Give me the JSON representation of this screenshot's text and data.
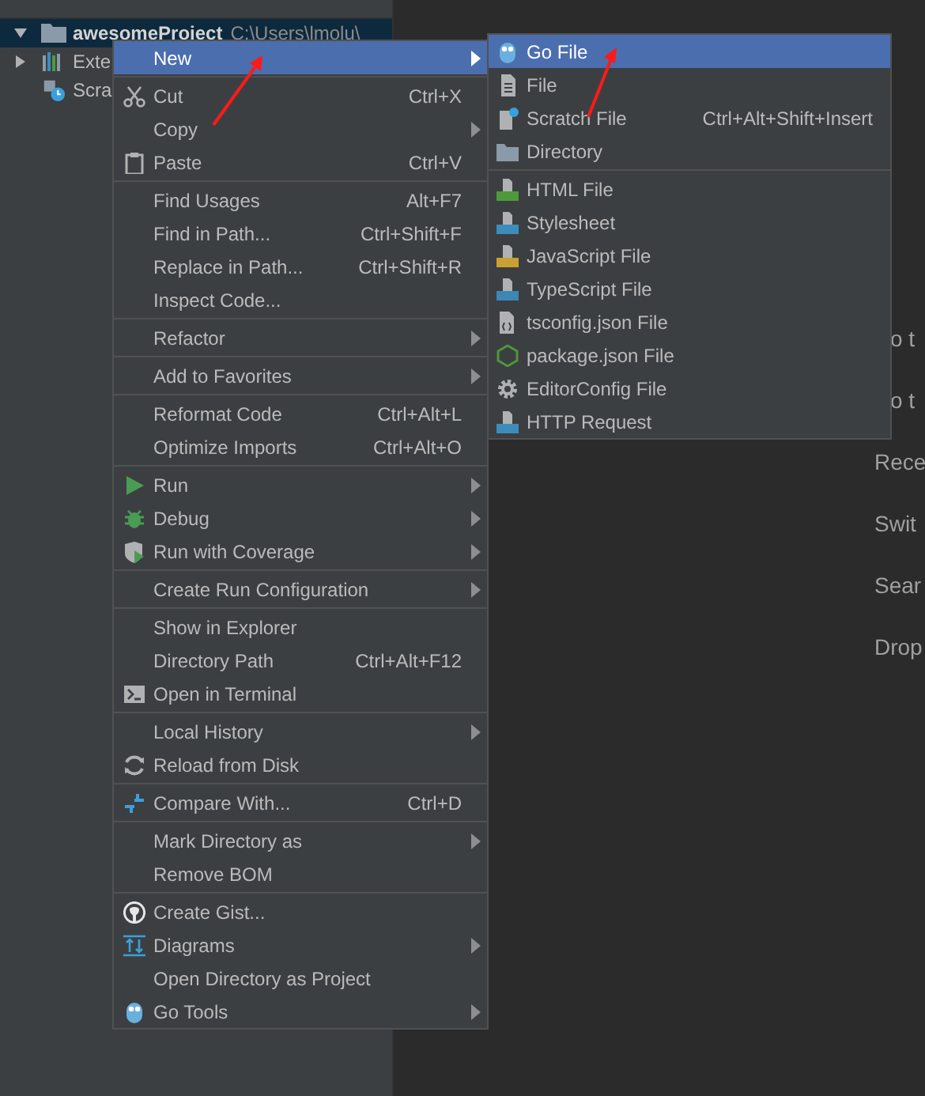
{
  "tree": [
    {
      "label": "awesomeProject",
      "path": "C:\\Users\\lmolu\\",
      "expanded": true,
      "selected": true,
      "bold": true
    },
    {
      "label": "Exte",
      "expanded": false,
      "selected": false,
      "bold": false
    },
    {
      "label": "Scra",
      "selected": false,
      "bold": false
    }
  ],
  "editor_hints": [
    "o t",
    "o t",
    "Rece",
    "Swit",
    "Sear",
    "Drop"
  ],
  "context_menu": {
    "groups": [
      [
        {
          "label": "New",
          "submenu": true,
          "selected": true
        }
      ],
      [
        {
          "label": "Cut",
          "shortcut": "Ctrl+X",
          "submenu": false,
          "selected": false
        },
        {
          "label": "Copy",
          "submenu": true,
          "selected": false
        },
        {
          "label": "Paste",
          "shortcut": "Ctrl+V",
          "submenu": false,
          "selected": false
        }
      ],
      [
        {
          "label": "Find Usages",
          "shortcut": "Alt+F7",
          "submenu": false,
          "selected": false
        },
        {
          "label": "Find in Path...",
          "shortcut": "Ctrl+Shift+F",
          "submenu": false,
          "selected": false
        },
        {
          "label": "Replace in Path...",
          "shortcut": "Ctrl+Shift+R",
          "submenu": false,
          "selected": false
        },
        {
          "label": "Inspect Code...",
          "submenu": false,
          "selected": false
        }
      ],
      [
        {
          "label": "Refactor",
          "submenu": true,
          "selected": false
        }
      ],
      [
        {
          "label": "Add to Favorites",
          "submenu": true,
          "selected": false
        }
      ],
      [
        {
          "label": "Reformat Code",
          "shortcut": "Ctrl+Alt+L",
          "submenu": false,
          "selected": false
        },
        {
          "label": "Optimize Imports",
          "shortcut": "Ctrl+Alt+O",
          "submenu": false,
          "selected": false
        }
      ],
      [
        {
          "label": "Run",
          "submenu": true,
          "selected": false
        },
        {
          "label": "Debug",
          "submenu": true,
          "selected": false
        },
        {
          "label": "Run with Coverage",
          "submenu": true,
          "selected": false
        }
      ],
      [
        {
          "label": "Create Run Configuration",
          "submenu": true,
          "selected": false
        }
      ],
      [
        {
          "label": "Show in Explorer",
          "submenu": false,
          "selected": false
        },
        {
          "label": "Directory Path",
          "shortcut": "Ctrl+Alt+F12",
          "submenu": false,
          "selected": false
        },
        {
          "label": "Open in Terminal",
          "submenu": false,
          "selected": false
        }
      ],
      [
        {
          "label": "Local History",
          "submenu": true,
          "selected": false
        },
        {
          "label": "Reload from Disk",
          "submenu": false,
          "selected": false
        }
      ],
      [
        {
          "label": "Compare With...",
          "shortcut": "Ctrl+D",
          "submenu": false,
          "selected": false
        }
      ],
      [
        {
          "label": "Mark Directory as",
          "submenu": true,
          "selected": false
        },
        {
          "label": "Remove BOM",
          "submenu": false,
          "selected": false
        }
      ],
      [
        {
          "label": "Create Gist...",
          "submenu": false,
          "selected": false
        },
        {
          "label": "Diagrams",
          "submenu": true,
          "selected": false
        },
        {
          "label": "Open Directory as Project",
          "submenu": false,
          "selected": false
        },
        {
          "label": "Go Tools",
          "submenu": true,
          "selected": false
        }
      ]
    ]
  },
  "new_submenu": {
    "groups": [
      [
        {
          "label": "Go File",
          "selected": true
        },
        {
          "label": "File",
          "selected": false
        },
        {
          "label": "Scratch File",
          "shortcut": "Ctrl+Alt+Shift+Insert",
          "selected": false
        },
        {
          "label": "Directory",
          "selected": false
        }
      ],
      [
        {
          "label": "HTML File",
          "selected": false
        },
        {
          "label": "Stylesheet",
          "selected": false
        },
        {
          "label": "JavaScript File",
          "selected": false
        },
        {
          "label": "TypeScript File",
          "selected": false
        },
        {
          "label": "tsconfig.json File",
          "selected": false
        },
        {
          "label": "package.json File",
          "selected": false
        },
        {
          "label": "EditorConfig File",
          "selected": false
        },
        {
          "label": "HTTP Request",
          "selected": false
        }
      ]
    ]
  }
}
